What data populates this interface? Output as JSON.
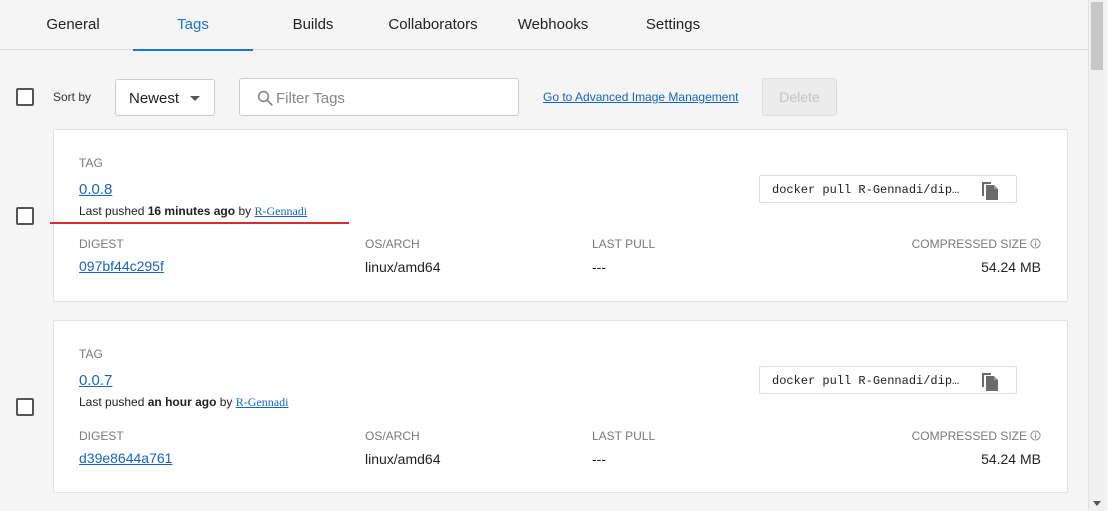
{
  "tabs": [
    "General",
    "Tags",
    "Builds",
    "Collaborators",
    "Webhooks",
    "Settings"
  ],
  "active_tab": "Tags",
  "toolbar": {
    "sort_label": "Sort by",
    "sort_value": "Newest",
    "filter_placeholder": "Filter Tags",
    "advanced_link": "Go to Advanced Image Management",
    "delete_label": "Delete"
  },
  "labels": {
    "tag": "TAG",
    "last_pushed": "Last pushed",
    "by": "by",
    "digest": "DIGEST",
    "os_arch": "OS/ARCH",
    "last_pull": "LAST PULL",
    "compressed_size": "COMPRESSED SIZE"
  },
  "tags": [
    {
      "name": "0.0.8",
      "pushed_ago": "16 minutes ago",
      "pushed_by": "R-Gennadi",
      "pull_command": "docker pull R-Gennadi/dip…",
      "digest": "097bf44c295f",
      "os_arch": "linux/amd64",
      "last_pull": "---",
      "compressed_size": "54.24 MB"
    },
    {
      "name": "0.0.7",
      "pushed_ago": "an hour ago",
      "pushed_by": "R-Gennadi",
      "pull_command": "docker pull R-Gennadi/dip…",
      "digest": "d39e8644a761",
      "os_arch": "linux/amd64",
      "last_pull": "---",
      "compressed_size": "54.24 MB"
    }
  ],
  "colors": {
    "accent": "#1976d2",
    "link": "#1565c0",
    "annotation": "#d32f2f"
  }
}
